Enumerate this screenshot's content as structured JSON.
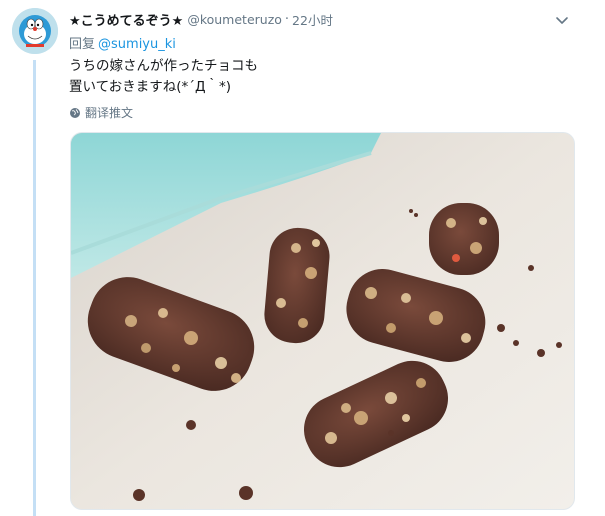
{
  "tweet": {
    "display_name": "★こうめてるぞう★",
    "handle": "@koumeteruzo",
    "separator": "·",
    "time": "22小时",
    "reply_prefix": "回复",
    "reply_mention": "@sumiyu_ki",
    "text_lines": [
      "うちの嫁さんが作ったチョコも",
      "置いておきますね(*´Д｀*)"
    ],
    "translate_label": "翻译推文",
    "icons": {
      "avatar": "doraemon-avatar",
      "menu": "chevron-down-icon",
      "translate": "globe-icon"
    },
    "colors": {
      "link": "#1b95e0",
      "thread_line": "#c4dff5",
      "muted": "#657786"
    }
  }
}
